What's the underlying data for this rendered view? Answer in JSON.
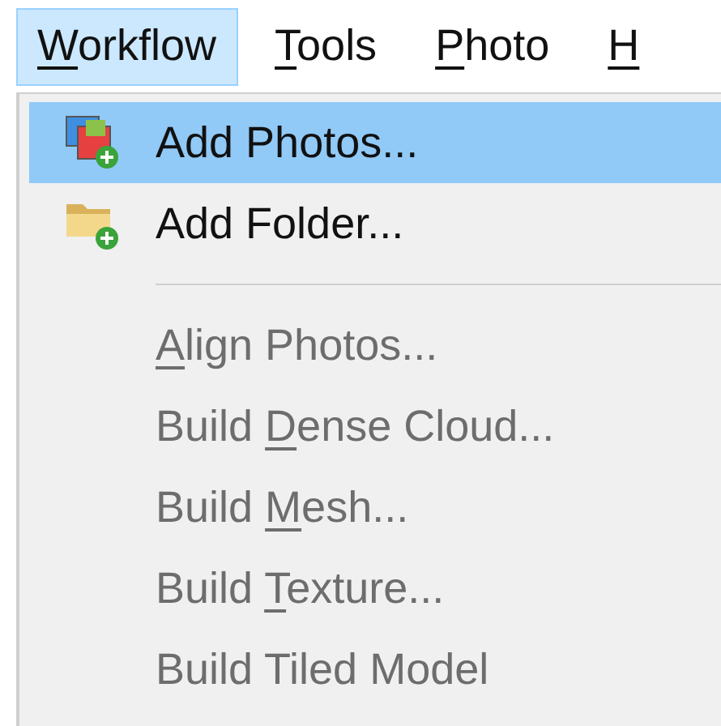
{
  "menu_bar": [
    {
      "parts": [
        {
          "text": "W",
          "underlined": true
        },
        {
          "text": "orkflow",
          "underlined": false
        }
      ],
      "selected": true
    },
    {
      "parts": [
        {
          "text": "T",
          "underlined": true
        },
        {
          "text": "ools",
          "underlined": false
        }
      ],
      "selected": false
    },
    {
      "parts": [
        {
          "text": "P",
          "underlined": true
        },
        {
          "text": "hoto",
          "underlined": false
        }
      ],
      "selected": false
    },
    {
      "parts": [
        {
          "text": "H",
          "underlined": true
        }
      ],
      "selected": false
    }
  ],
  "menu": [
    {
      "kind": "photos",
      "parts": [
        {
          "text": "Add Photos...",
          "underlined": false
        }
      ],
      "selected": true,
      "disabled": false
    },
    {
      "kind": "folder",
      "parts": [
        {
          "text": "Add Folder...",
          "underlined": false
        }
      ],
      "selected": false,
      "disabled": false
    },
    {
      "kind": "separator"
    },
    {
      "kind": "item",
      "parts": [
        {
          "text": "A",
          "underlined": true
        },
        {
          "text": "lign Photos...",
          "underlined": false
        }
      ],
      "selected": false,
      "disabled": true
    },
    {
      "kind": "item",
      "parts": [
        {
          "text": "Build ",
          "underlined": false
        },
        {
          "text": "D",
          "underlined": true
        },
        {
          "text": "ense Cloud...",
          "underlined": false
        }
      ],
      "selected": false,
      "disabled": true
    },
    {
      "kind": "item",
      "parts": [
        {
          "text": "Build ",
          "underlined": false
        },
        {
          "text": "M",
          "underlined": true
        },
        {
          "text": "esh...",
          "underlined": false
        }
      ],
      "selected": false,
      "disabled": true
    },
    {
      "kind": "item",
      "parts": [
        {
          "text": "Build ",
          "underlined": false
        },
        {
          "text": "T",
          "underlined": true
        },
        {
          "text": "exture...",
          "underlined": false
        }
      ],
      "selected": false,
      "disabled": true
    },
    {
      "kind": "item",
      "parts": [
        {
          "text": "Build Tiled Model",
          "underlined": false
        }
      ],
      "selected": false,
      "disabled": true
    }
  ]
}
